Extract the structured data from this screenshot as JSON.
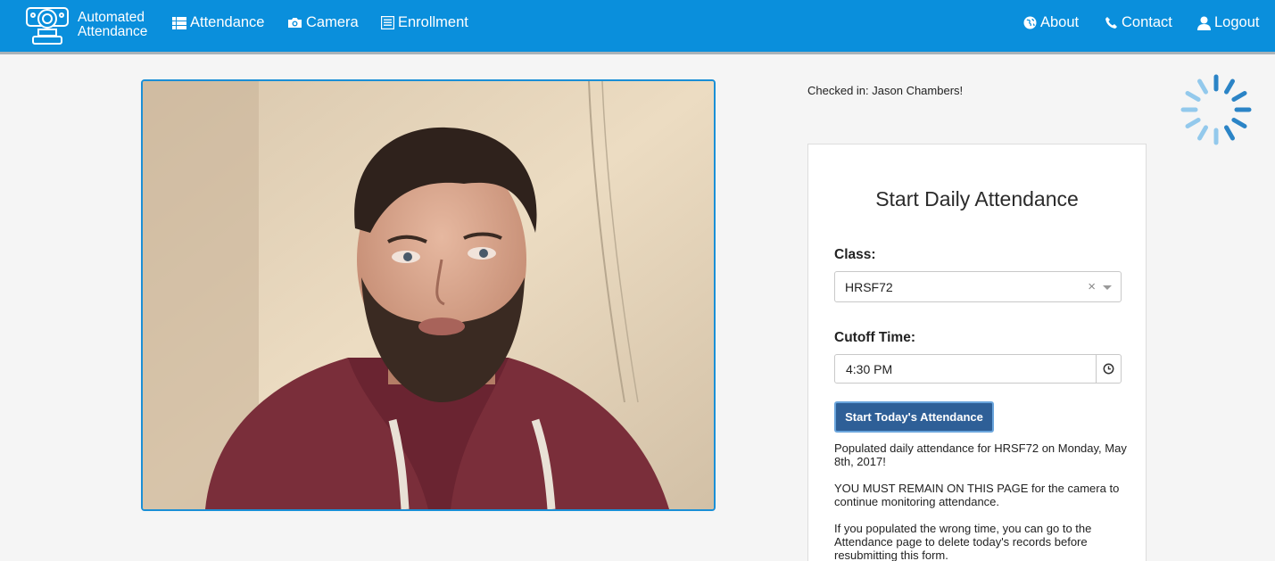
{
  "brand": {
    "line1": "Automated",
    "line2": "Attendance",
    "logo_icon": "camera-logo-icon"
  },
  "nav": {
    "left": [
      {
        "label": "Attendance",
        "icon": "list-icon"
      },
      {
        "label": "Camera",
        "icon": "camera-icon"
      },
      {
        "label": "Enrollment",
        "icon": "form-icon"
      }
    ],
    "right": [
      {
        "label": "About",
        "icon": "globe-icon"
      },
      {
        "label": "Contact",
        "icon": "phone-icon"
      },
      {
        "label": "Logout",
        "icon": "user-icon"
      }
    ]
  },
  "status": {
    "checked_in": "Checked in: Jason Chambers!"
  },
  "panel": {
    "title": "Start Daily Attendance",
    "class_label": "Class:",
    "class_value": "HRSF72",
    "cutoff_label": "Cutoff Time:",
    "cutoff_value": "4:30 PM",
    "start_button": "Start Today's Attendance",
    "messages": [
      "Populated daily attendance for HRSF72 on Monday, May 8th, 2017!",
      "YOU MUST REMAIN ON THIS PAGE for the camera to continue monitoring attendance.",
      "If you populated the wrong time, you can go to the Attendance page to delete today's records before resubmitting this form."
    ]
  },
  "colors": {
    "navbar": "#0a8fdc",
    "button": "#2e5f97",
    "camera_border": "#1a8fd6"
  }
}
